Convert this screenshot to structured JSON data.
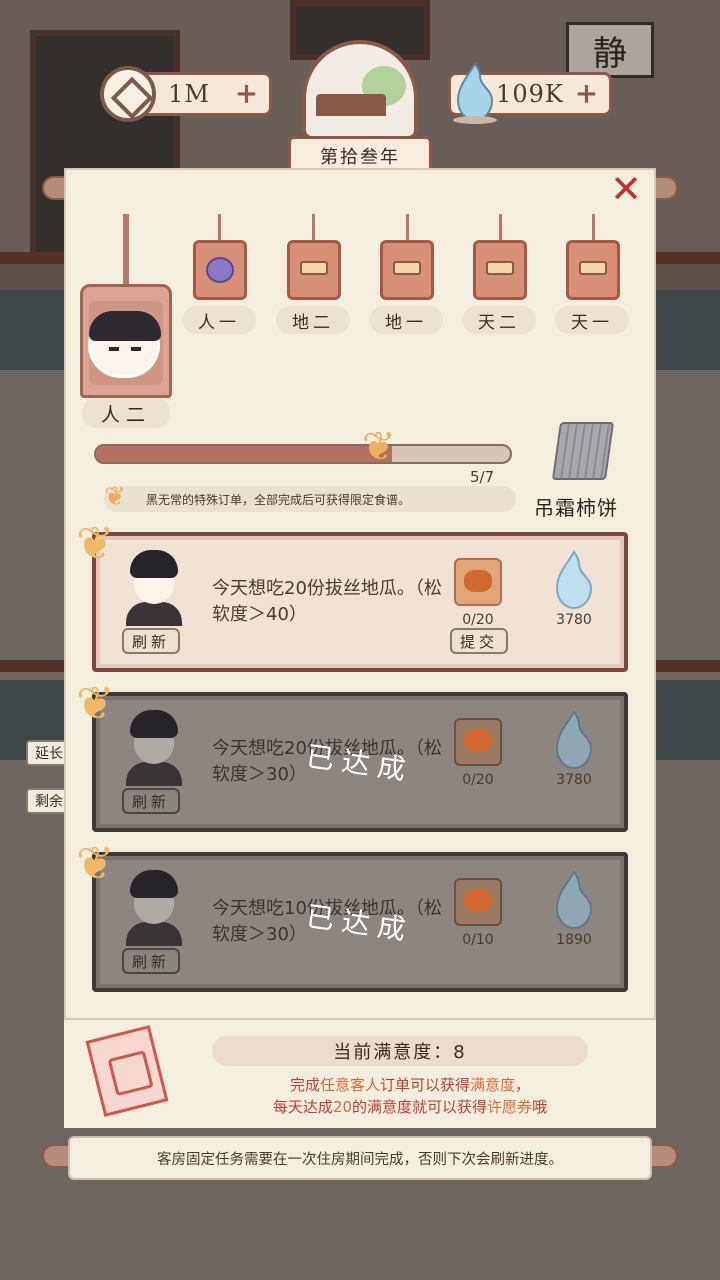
{
  "header": {
    "coins": "1M",
    "spirit": "109K",
    "plus": "+",
    "year": "第拾叁年",
    "calligraphy": "静"
  },
  "close_label": "✕",
  "tags": {
    "current": "人二",
    "items": [
      "人一",
      "地二",
      "地一",
      "天二",
      "天一"
    ]
  },
  "progress": {
    "value": 5,
    "max": 7,
    "text": "5/7",
    "hint": "黑无常的特殊订单，全部完成后可获得限定食谱。"
  },
  "reward": {
    "name": "吊霜柿饼"
  },
  "orders": [
    {
      "text": "今天想吃20份拔丝地瓜。（松软度＞40）",
      "food_count": "0/20",
      "spirit_count": "3780",
      "refresh": "刷新",
      "submit": "提交",
      "done": false
    },
    {
      "text": "今天想吃20份拔丝地瓜。（松软度＞30）",
      "food_count": "0/20",
      "spirit_count": "3780",
      "refresh": "刷新",
      "stamp": "已达成",
      "done": true
    },
    {
      "text": "今天想吃10份拔丝地瓜。（松软度＞30）",
      "food_count": "0/10",
      "spirit_count": "1890",
      "refresh": "刷新",
      "stamp": "已达成",
      "done": true
    }
  ],
  "side": {
    "extend": "延长",
    "remain": "剩余"
  },
  "satisfaction": {
    "title": "当前满意度：8",
    "line1_a": "完成",
    "line1_b": "任意客人",
    "line1_c": "订单可以获得",
    "line1_d": "满意度",
    "line1_e": "，",
    "line2_a": "每天达成",
    "line2_b": "20",
    "line2_c": "的满意度就可以获得",
    "line2_d": "许愿券",
    "line2_e": "哦"
  },
  "footer_note": "客房固定任务需要在一次住房期间完成，否则下次会刷新进度。",
  "colors": {
    "accent": "#8a5a48",
    "done_overlay": "#8d8680",
    "highlight": "#c0402e"
  }
}
